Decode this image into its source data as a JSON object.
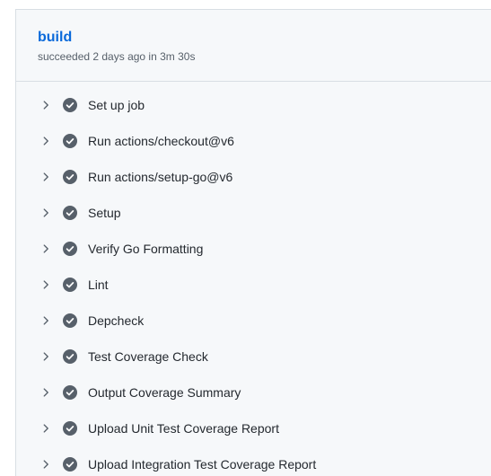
{
  "job": {
    "title": "build",
    "meta": "succeeded 2 days ago in 3m 30s"
  },
  "steps": [
    {
      "label": "Set up job",
      "status": "success"
    },
    {
      "label": "Run actions/checkout@v6",
      "status": "success"
    },
    {
      "label": "Run actions/setup-go@v6",
      "status": "success"
    },
    {
      "label": "Setup",
      "status": "success"
    },
    {
      "label": "Verify Go Formatting",
      "status": "success"
    },
    {
      "label": "Lint",
      "status": "success"
    },
    {
      "label": "Depcheck",
      "status": "success"
    },
    {
      "label": "Test Coverage Check",
      "status": "success"
    },
    {
      "label": "Output Coverage Summary",
      "status": "success"
    },
    {
      "label": "Upload Unit Test Coverage Report",
      "status": "success"
    },
    {
      "label": "Upload Integration Test Coverage Report",
      "status": "success"
    }
  ],
  "icons": {
    "expand": "chevron-right-icon",
    "status": "check-circle-icon"
  },
  "colors": {
    "title": "#0969da",
    "check": "#57606a",
    "text": "#24292f",
    "panel_bg": "#f6f8fa"
  }
}
